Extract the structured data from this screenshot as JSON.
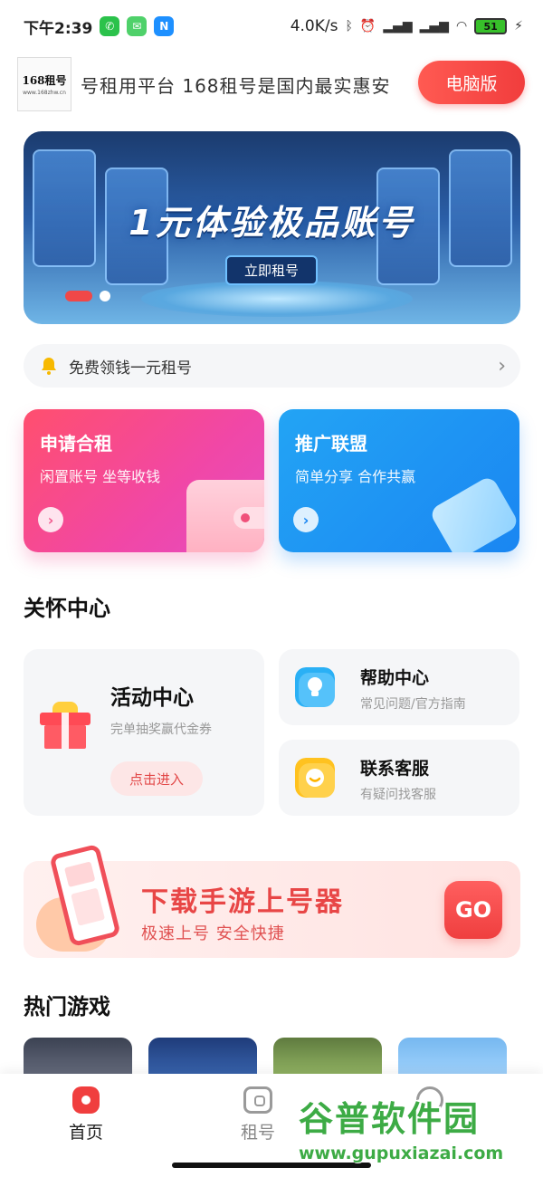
{
  "status_bar": {
    "time": "下午2:39",
    "network_speed": "4.0K/s",
    "battery": "51",
    "icons": [
      "wechat-icon",
      "message-icon",
      "n-app-icon",
      "bluetooth-icon",
      "alarm-icon",
      "hd-signal-icon",
      "wifi-icon",
      "charging-icon"
    ]
  },
  "header": {
    "logo_text": "168租号",
    "logo_sub": "www.168zhw.cn",
    "marquee": "号租用平台   168租号是国内最实惠安",
    "pc_button": "电脑版"
  },
  "banner": {
    "title": "1元体验极品账号",
    "button": "立即租号",
    "dots": 2,
    "active_dot": 0
  },
  "notice": {
    "text": "免费领钱一元租号",
    "icon": "bell-icon"
  },
  "promo_cards": [
    {
      "title": "申请合租",
      "subtitle": "闲置账号 坐等收钱",
      "color": "#f147a6"
    },
    {
      "title": "推广联盟",
      "subtitle": "简单分享 合作共赢",
      "color": "#1a86f2"
    }
  ],
  "care_center": {
    "title": "关怀中心",
    "activity": {
      "title": "活动中心",
      "subtitle": "完单抽奖赢代金券",
      "button": "点击进入"
    },
    "help": {
      "title": "帮助中心",
      "subtitle": "常见问题/官方指南"
    },
    "service": {
      "title": "联系客服",
      "subtitle": "有疑问找客服"
    }
  },
  "download_banner": {
    "title": "下载手游上号器",
    "subtitle": "极速上号 安全快捷",
    "button": "GO"
  },
  "hot_games": {
    "title": "热门游戏"
  },
  "tabbar": {
    "items": [
      {
        "label": "首页",
        "active": true
      },
      {
        "label": "租号",
        "active": false
      },
      {
        "label": "",
        "active": false
      }
    ]
  },
  "watermark": {
    "main": "谷普软件园",
    "url": "www.gupuxiazai.com"
  },
  "colors": {
    "accent": "#f03e3e",
    "pink": "#f147a6",
    "blue": "#1a86f2"
  }
}
